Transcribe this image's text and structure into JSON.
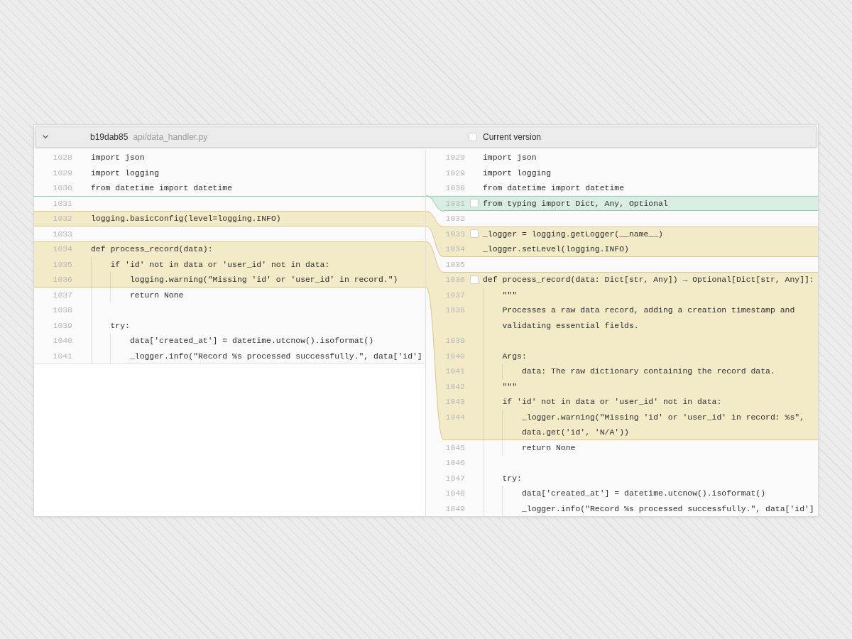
{
  "header": {
    "expanded": true,
    "commit": "b19dab85",
    "path": "api/data_handler.py",
    "version_toggle": {
      "label": "Current version",
      "checked": false
    }
  },
  "left": {
    "lines": [
      {
        "number": "1028",
        "kind": "unchanged",
        "code": "import json"
      },
      {
        "number": "1029",
        "kind": "unchanged",
        "code": "import logging"
      },
      {
        "number": "1030",
        "kind": "unchanged",
        "code": "from datetime import datetime"
      },
      {
        "number": "1031",
        "kind": "insertion"
      },
      {
        "number": "1032",
        "kind": "modified",
        "code": "logging.basicConfig(level=logging.INFO)"
      },
      {
        "number": "1033",
        "kind": "unchanged"
      },
      {
        "number": "1034",
        "kind": "modified",
        "code": "def process_record(data):"
      },
      {
        "number": "1035",
        "kind": "modified",
        "code": "    if 'id' not in data or 'user_id' not in data:"
      },
      {
        "number": "1036",
        "kind": "modified",
        "code": "        logging.warning(\"Missing 'id' or 'user_id' in record.\")"
      },
      {
        "number": "1037",
        "kind": "unchanged",
        "code": "        return None"
      },
      {
        "number": "1038",
        "kind": "unchanged"
      },
      {
        "number": "1039",
        "kind": "unchanged",
        "code": "    try:"
      },
      {
        "number": "1040",
        "kind": "unchanged",
        "code": "        data['created_at'] = datetime.utcnow().isoformat()"
      },
      {
        "number": "1041",
        "kind": "unchanged",
        "code": "        _logger.info(\"Record %s processed successfully.\", data['id']"
      }
    ]
  },
  "right": {
    "lines": [
      {
        "number": "1029",
        "kind": "unchanged",
        "code": "import json"
      },
      {
        "number": "1029",
        "kind": "unchanged",
        "code": "import logging"
      },
      {
        "number": "1030",
        "kind": "unchanged",
        "code": "from datetime import datetime"
      },
      {
        "number": "1031",
        "kind": "added",
        "checked": false,
        "code": "from typing import Dict, Any, Optional"
      },
      {
        "number": "1032",
        "kind": "unchanged"
      },
      {
        "number": "1033",
        "kind": "modified",
        "checked": false,
        "code": "_logger = logging.getLogger(__name__)"
      },
      {
        "number": "1034",
        "kind": "modified",
        "code": "_logger.setLevel(logging.INFO)"
      },
      {
        "number": "1035",
        "kind": "unchanged"
      },
      {
        "number": "1036",
        "kind": "modified",
        "checked": false,
        "code": "def process_record(data: Dict[str, Any]) → Optional[Dict[str, Any]]:"
      },
      {
        "number": "1037",
        "kind": "modified",
        "code": "    \"\"\""
      },
      {
        "number": "1038",
        "kind": "modified",
        "code": "    Processes a raw data record, adding a creation timestamp and validating essential fields."
      },
      {
        "number": "1039",
        "kind": "modified"
      },
      {
        "number": "1040",
        "kind": "modified",
        "code": "    Args:"
      },
      {
        "number": "1041",
        "kind": "modified",
        "code": "        data: The raw dictionary containing the record data."
      },
      {
        "number": "1042",
        "kind": "modified",
        "code": "    \"\"\""
      },
      {
        "number": "1043",
        "kind": "modified",
        "code": "    if 'id' not in data or 'user_id' not in data:"
      },
      {
        "number": "1044",
        "kind": "modified",
        "code": "        _logger.warning(\"Missing 'id' or 'user_id' in record: %s\", data.get('id', 'N/A'))"
      },
      {
        "number": "1045",
        "kind": "unchanged",
        "code": "        return None"
      },
      {
        "number": "1046",
        "kind": "unchanged"
      },
      {
        "number": "1047",
        "kind": "unchanged",
        "code": "    try:"
      },
      {
        "number": "1048",
        "kind": "unchanged",
        "code": "        data['created_at'] = datetime.utcnow().isoformat()"
      },
      {
        "number": "1049",
        "kind": "unchanged",
        "code": "        _logger.info(\"Record %s processed successfully.\", data['id']"
      }
    ]
  }
}
